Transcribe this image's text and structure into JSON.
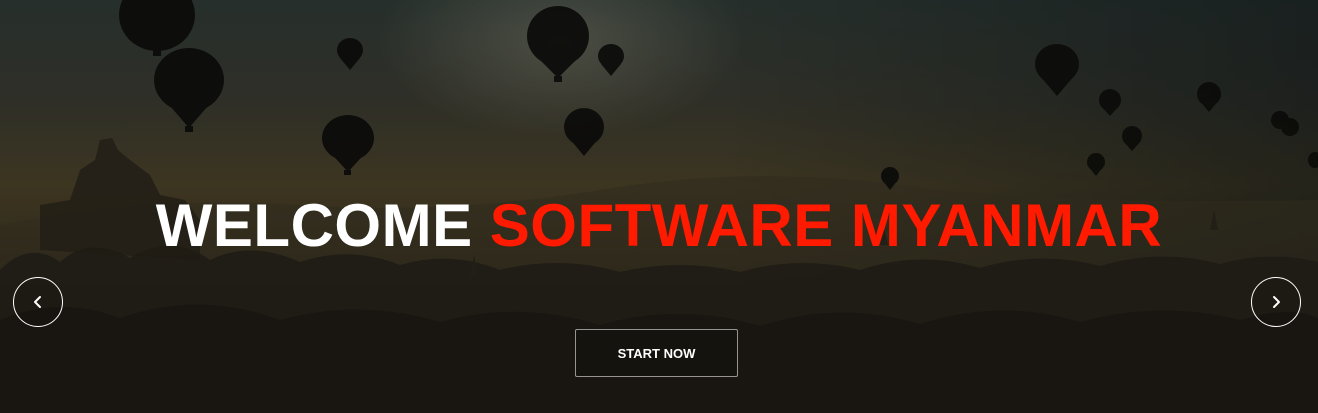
{
  "hero": {
    "headline_white": "WELCOME",
    "headline_red": "SOFTWARE MYANMAR",
    "cta_label": "START NOW",
    "accent_color": "#ff1a00",
    "text_color": "#ffffff"
  },
  "carousel": {
    "prev_icon": "chevron-left-icon",
    "next_icon": "chevron-right-icon"
  },
  "background": {
    "scene": "hot-air-balloons-over-temples"
  }
}
